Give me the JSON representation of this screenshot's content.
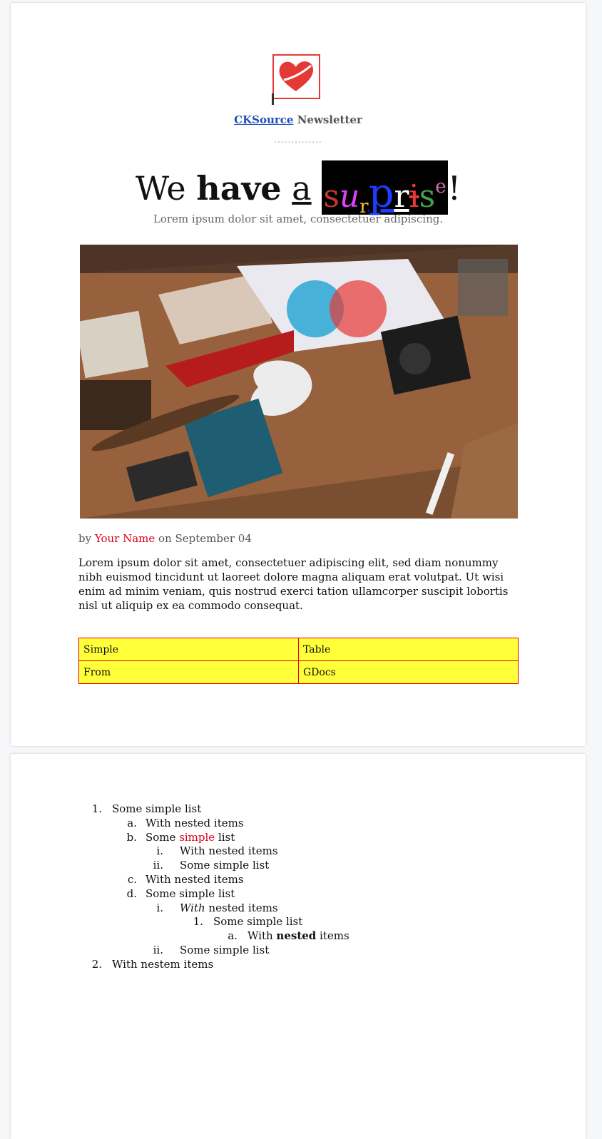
{
  "header": {
    "brand_link": "CKSource",
    "brand_suffix": "Newsletter",
    "dots": "..............",
    "headline": {
      "we": "We",
      "have": "have",
      "a": "a",
      "surprise_letters": [
        {
          "ch": "s",
          "color": "#c0392b"
        },
        {
          "ch": "u",
          "color": "#e040fb"
        },
        {
          "ch": "r",
          "color": "#f4c542"
        },
        {
          "ch": "p",
          "color": "#1e3cff"
        },
        {
          "ch": "r",
          "color": "#ffffff"
        },
        {
          "ch": "i",
          "color": "#e53935"
        },
        {
          "ch": "s",
          "color": "#43a047"
        },
        {
          "ch": "e",
          "color": "#d16fb5"
        }
      ],
      "bang": "!"
    },
    "subhead": "Lorem ipsum dolor sit amet, consectetuer adipiscing."
  },
  "byline": {
    "by": "by",
    "name": "Your Name",
    "on": "on September 04"
  },
  "body": "Lorem ipsum dolor sit amet, consectetuer adipiscing elit, sed diam nonummy nibh euismod tincidunt ut laoreet dolore magna aliquam erat volutpat. Ut wisi enim ad minim veniam, quis nostrud exerci tation ullamcorper suscipit lobortis nisl ut aliquip ex ea commodo consequat.",
  "table": [
    [
      "Simple",
      "Table"
    ],
    [
      "From",
      "GDocs"
    ]
  ],
  "list": {
    "m1": "1.",
    "t1": "Some simple list",
    "m1a": "a.",
    "t1a": "With nested items",
    "m1b": "b.",
    "t1b_pre": "Some ",
    "t1b_red": "simple",
    "t1b_post": " list",
    "m1bi": "i.",
    "t1bi": "With nested items",
    "m1bii": "ii.",
    "t1bii": "Some simple list",
    "m1c": "c.",
    "t1c": "With nested items",
    "m1d": "d.",
    "t1d": "Some simple list",
    "m1di": "i.",
    "t1di_it": "With",
    "t1di_rest": " nested items",
    "m1di1": "1.",
    "t1di1": "Some simple list",
    "m1di1a": "a.",
    "t1di1a_pre": "With ",
    "t1di1a_b": "nested",
    "t1di1a_post": " items",
    "m1dii": "ii.",
    "t1dii": "Some simple list",
    "m2": "2.",
    "t2": "With nestem items"
  }
}
